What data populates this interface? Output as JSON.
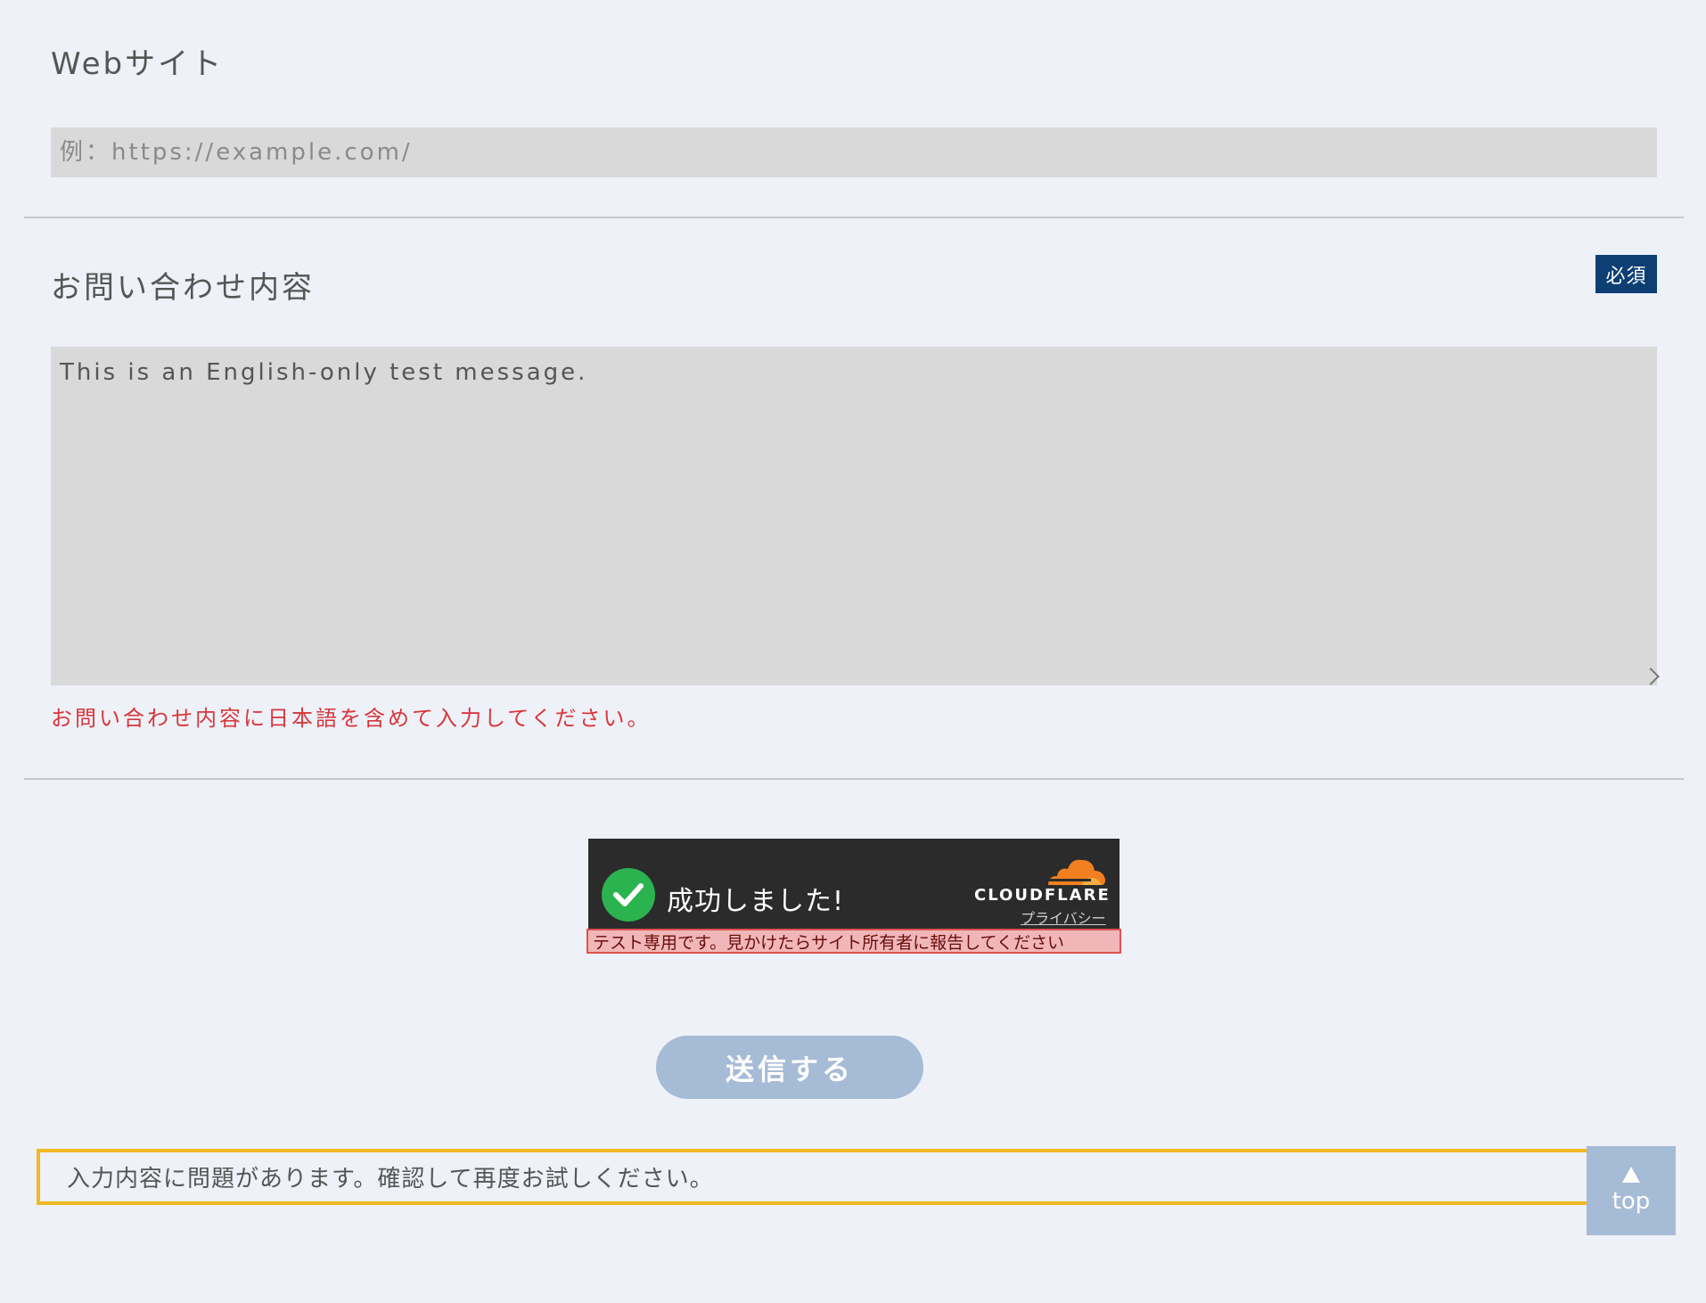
{
  "website_field": {
    "label": "Webサイト",
    "placeholder": "例：https://example.com/",
    "value": ""
  },
  "inquiry_field": {
    "label": "お問い合わせ内容",
    "required_badge": "必須",
    "value": "This is an English-only test message.",
    "error": "お問い合わせ内容に日本語を含めて入力してください。"
  },
  "turnstile": {
    "status": "成功しました!",
    "brand": "CLOUDFLARE",
    "privacy_link": "プライバシー",
    "test_notice": "テスト専用です。見かけたらサイト所有者に報告してください"
  },
  "submit_button": {
    "label": "送信する"
  },
  "form_error": {
    "message": "入力内容に問題があります。確認して再度お試しください。"
  },
  "back_to_top": {
    "label": "top"
  },
  "colors": {
    "background": "#eef1f8",
    "input_bg": "#d9d9d9",
    "required_badge": "#0d3f73",
    "error_text": "#d7373b",
    "button": "#a6bbd5",
    "alert_border": "#f0b922",
    "turnstile_bg": "#2b2b2b",
    "success_check": "#2bb350",
    "cloudflare_orange": "#f38020"
  }
}
